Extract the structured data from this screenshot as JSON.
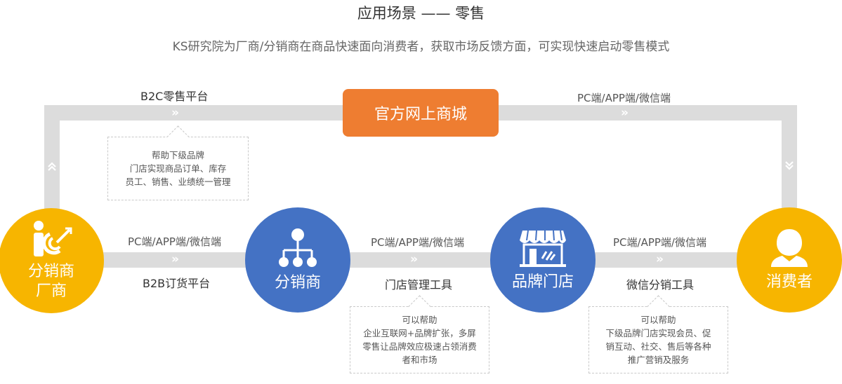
{
  "header": {
    "title": "应用场景 —— 零售",
    "subtitle": "KS研究院为厂商/分销商在商品快速面向消费者，获取市场反馈方面，可实现快速启动零售模式"
  },
  "top_route": {
    "left_label": "B2C零售平台",
    "center_box": "官方网上商城",
    "right_label": "PC端/APP端/微信端"
  },
  "nodes": {
    "manufacturer": {
      "line1": "分销商",
      "line2": "厂商"
    },
    "distributor": {
      "label": "分销商"
    },
    "store": {
      "label": "品牌门店"
    },
    "consumer": {
      "label": "消费者"
    }
  },
  "segments": {
    "seg1": {
      "top": "PC端/APP端/微信端",
      "bottom": "B2B订货平台"
    },
    "seg2": {
      "top": "PC端/APP端/微信端",
      "bottom": "门店管理工具"
    },
    "seg3": {
      "top": "PC端/APP端/微信端",
      "bottom": "微信分销工具"
    }
  },
  "notes": {
    "b2c": [
      "帮助下级品牌",
      "门店实现商品订单、库存",
      "员工、销售、业绩统一管理"
    ],
    "store_tool": [
      "可以帮助",
      "企业互联网+品牌扩张，多屏",
      "零售让品牌效应极速占领消费",
      "者和市场"
    ],
    "wechat_tool": [
      "可以帮助",
      "下级品牌门店实现会员、促",
      "销互动、社交、售后等各种",
      "推广营销及服务"
    ]
  },
  "colors": {
    "orange": "#ee7d31",
    "yellow": "#f7b500",
    "blue": "#4472c4",
    "track": "#dcdcdc"
  }
}
